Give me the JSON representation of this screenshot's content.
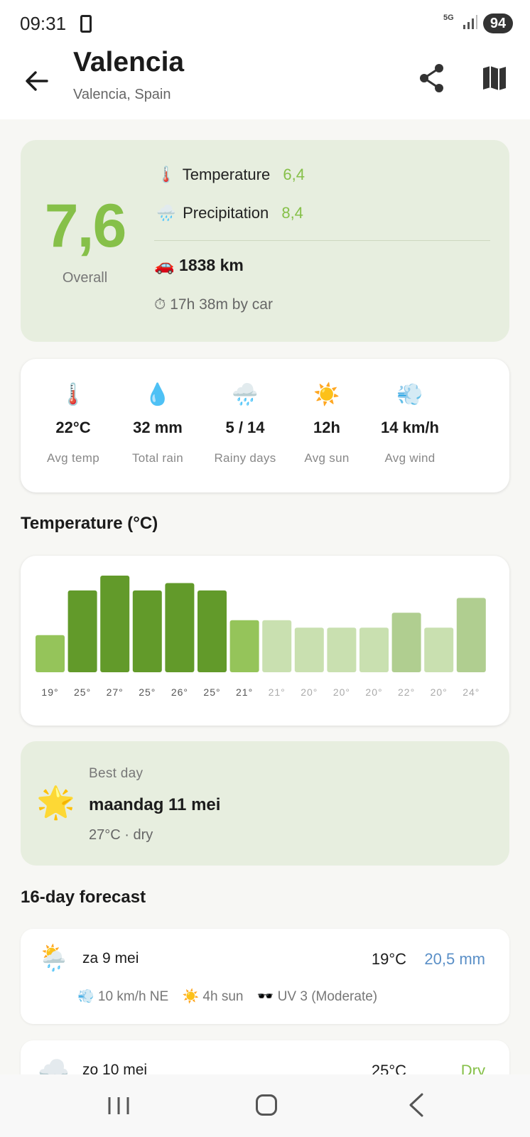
{
  "status": {
    "time": "09:31",
    "network": "5G",
    "battery": "94"
  },
  "header": {
    "title": "Valencia",
    "subtitle": "Valencia, Spain",
    "back_icon": "arrow-left-icon",
    "share_icon": "share-icon",
    "map_icon": "map-icon"
  },
  "score": {
    "overall_value": "7,6",
    "overall_label": "Overall",
    "temperature": {
      "emoji": "🌡️",
      "label": "Temperature",
      "value": "6,4"
    },
    "precipitation": {
      "emoji": "🌧️",
      "label": "Precipitation",
      "value": "8,4"
    },
    "distance": {
      "emoji": "🚗",
      "value": "1838 km"
    },
    "duration": {
      "emoji": "⏱",
      "value": "17h 38m by car"
    }
  },
  "stats": [
    {
      "emoji": "🌡️",
      "value": "22°C",
      "label": "Avg temp"
    },
    {
      "emoji": "💧",
      "value": "32 mm",
      "label": "Total rain"
    },
    {
      "emoji": "🌧️",
      "value": "5 / 14",
      "label": "Rainy days"
    },
    {
      "emoji": "☀️",
      "value": "12h",
      "label": "Avg sun"
    },
    {
      "emoji": "💨",
      "value": "14 km/h",
      "label": "Avg wind"
    }
  ],
  "temperature_section_title": "Temperature (°C)",
  "chart_data": {
    "type": "bar",
    "categories": [
      "19°",
      "25°",
      "27°",
      "25°",
      "26°",
      "25°",
      "21°",
      "21°",
      "20°",
      "20°",
      "20°",
      "22°",
      "20°",
      "24°"
    ],
    "values": [
      19,
      25,
      27,
      25,
      26,
      25,
      21,
      21,
      20,
      20,
      20,
      22,
      20,
      24
    ],
    "bar_colors": [
      "#95c45a",
      "#629a2a",
      "#629a2a",
      "#629a2a",
      "#629a2a",
      "#629a2a",
      "#95c45a",
      "#c9e0b0",
      "#c9e0b0",
      "#c9e0b0",
      "#c9e0b0",
      "#b0ce90",
      "#c9e0b0",
      "#b0ce90"
    ],
    "label_colors": [
      "#555555",
      "#555555",
      "#555555",
      "#555555",
      "#555555",
      "#555555",
      "#555555",
      "#aaaaaa",
      "#aaaaaa",
      "#aaaaaa",
      "#aaaaaa",
      "#aaaaaa",
      "#aaaaaa",
      "#aaaaaa"
    ],
    "ylim": [
      14,
      27
    ],
    "title": "",
    "xlabel": "",
    "ylabel": ""
  },
  "best_day": {
    "emoji": "🌟",
    "label": "Best day",
    "date": "maandag 11 mei",
    "detail": "27°C · dry"
  },
  "forecast_title": "16-day forecast",
  "forecast": [
    {
      "emoji": "🌦️",
      "date": "za 9 mei",
      "temp": "19°C",
      "rain": "20,5 mm",
      "wind": "💨 10 km/h NE",
      "sun": "☀️ 4h sun",
      "uv": "🕶️ UV 3 (Moderate)"
    },
    {
      "emoji": "☁️",
      "date": "zo 10 mei",
      "temp": "25°C",
      "rain": "Dry"
    }
  ],
  "colors": {
    "accent_green": "#86c049",
    "rain_blue": "#5a8fc7",
    "score_card_bg": "#e7eedf"
  }
}
